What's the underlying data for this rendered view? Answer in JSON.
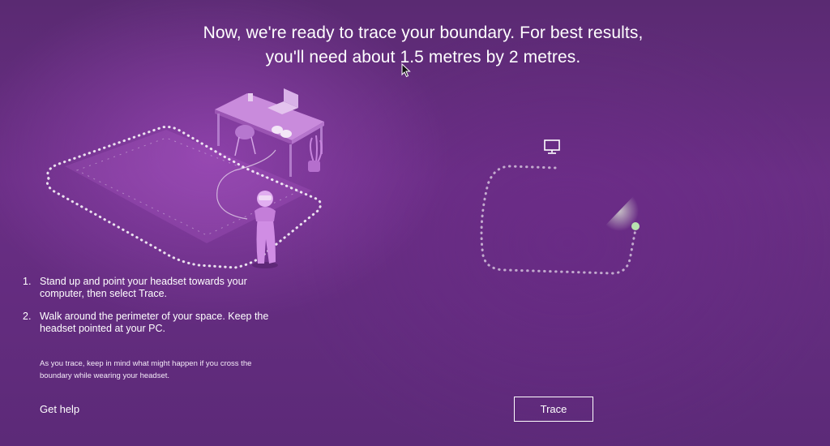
{
  "heading": {
    "line1": "Now, we're ready to trace your boundary. For best results,",
    "line2": "you'll need about 1.5 metres by 2 metres."
  },
  "steps": [
    {
      "number": "1.",
      "text": "Stand up and point your headset towards your computer, then select Trace."
    },
    {
      "number": "2.",
      "text": "Walk around the perimeter of your space. Keep the headset pointed at your PC."
    }
  ],
  "note": "As you trace, keep in mind what might happen if you cross the boundary while wearing your headset.",
  "help_link": "Get help",
  "trace_button": "Trace",
  "icons": {
    "pc": "monitor-icon",
    "cursor": "mouse-cursor-icon"
  },
  "colors": {
    "background": "#5c2a78",
    "accent": "#c77be0",
    "tracker_dot": "#b9e3b0"
  }
}
